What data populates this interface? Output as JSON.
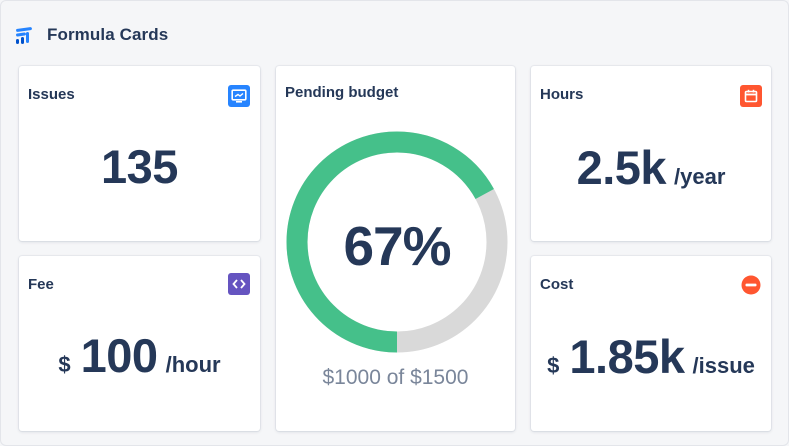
{
  "header": {
    "title": "Formula Cards",
    "icon": "formula-cards-logo-icon"
  },
  "colors": {
    "accent_blue": "#2684ff",
    "accent_purple": "#6554c0",
    "accent_red": "#ff5630",
    "donut_green": "#45c08a",
    "donut_track": "#d9d9d9",
    "text_dark": "#253858",
    "text_muted": "#7a869a"
  },
  "cards": {
    "issues": {
      "title": "Issues",
      "value": "135",
      "icon": "monitor-icon"
    },
    "budget": {
      "title": "Pending budget",
      "percent_label": "67%",
      "progress": 0.67,
      "detail": "$1000 of $1500"
    },
    "hours": {
      "title": "Hours",
      "value": "2.5k",
      "unit": "/year",
      "icon": "calendar-icon"
    },
    "fee": {
      "title": "Fee",
      "prefix": "$",
      "value": "100",
      "unit": "/hour",
      "icon": "code-icon"
    },
    "cost": {
      "title": "Cost",
      "prefix": "$",
      "value": "1.85k",
      "unit": "/issue",
      "icon": "minus-circle-icon"
    }
  }
}
